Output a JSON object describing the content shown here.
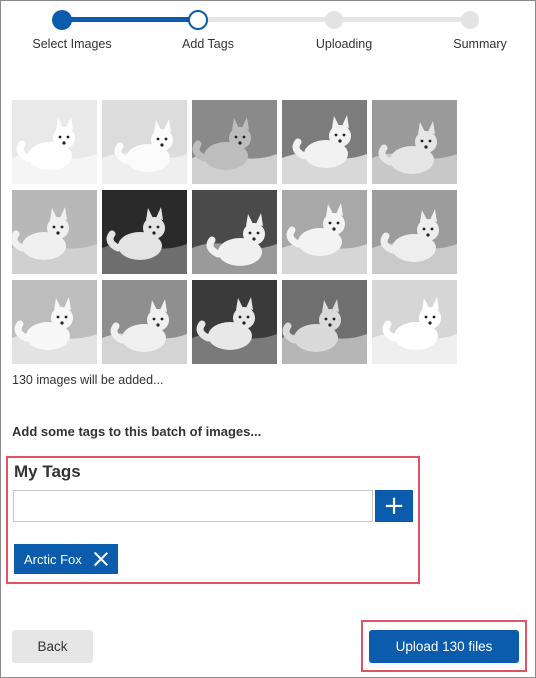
{
  "stepper": {
    "steps": [
      {
        "label": "Select Images",
        "state": "done"
      },
      {
        "label": "Add Tags",
        "state": "current"
      },
      {
        "label": "Uploading",
        "state": "todo"
      },
      {
        "label": "Summary",
        "state": "todo"
      }
    ],
    "accent": "#0b5cad"
  },
  "gallery": {
    "image_count_text": "130 images will be added...",
    "thumbnails": [
      "arctic-fox-photo",
      "arctic-fox-photo",
      "arctic-fox-photo",
      "arctic-fox-photo",
      "arctic-fox-photo",
      "arctic-fox-photo",
      "arctic-fox-photo",
      "arctic-fox-photo",
      "arctic-fox-photo",
      "arctic-fox-photo",
      "arctic-fox-photo",
      "arctic-fox-photo",
      "arctic-fox-photo",
      "arctic-fox-photo",
      "arctic-fox-photo"
    ]
  },
  "tags": {
    "prompt": "Add some tags to this batch of images...",
    "title": "My Tags",
    "input_value": "",
    "add_icon": "plus-icon",
    "items": [
      {
        "label": "Arctic Fox",
        "remove_icon": "close-icon"
      }
    ]
  },
  "footer": {
    "back_label": "Back",
    "upload_label": "Upload 130 files"
  },
  "colors": {
    "primary": "#0b5cad",
    "highlight": "#e05561",
    "secondary_button": "#e6e6e6"
  }
}
